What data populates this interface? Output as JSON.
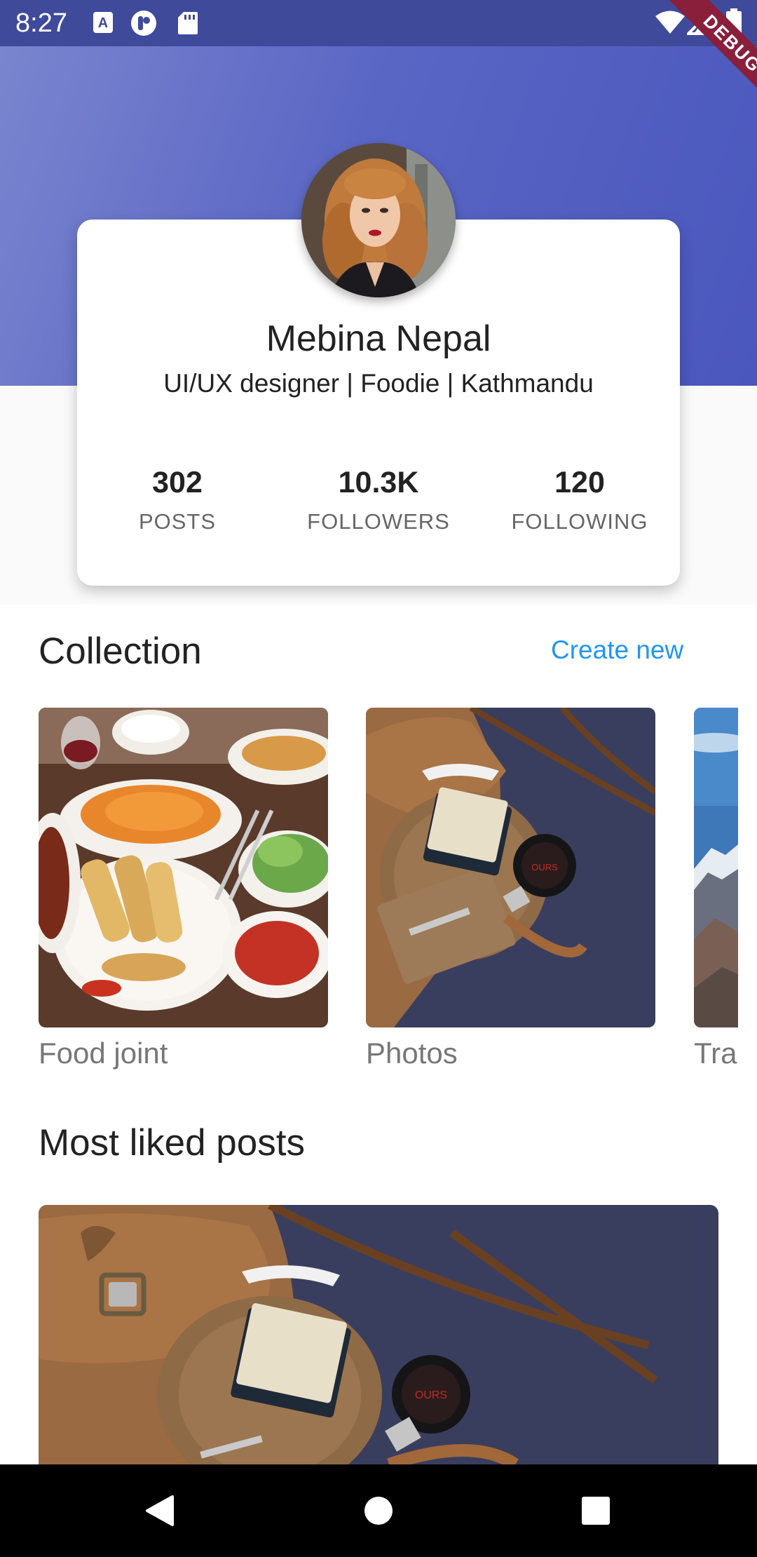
{
  "status_bar": {
    "time": "8:27",
    "icons": [
      "a-box-icon",
      "pocket-casts-icon",
      "sd-card-icon",
      "wifi-icon",
      "cell-signal-icon",
      "battery-icon"
    ]
  },
  "debug_banner": "DEBUG",
  "profile": {
    "name": "Mebina Nepal",
    "bio": "UI/UX designer | Foodie | Kathmandu",
    "stats": [
      {
        "value": "302",
        "label": "POSTS"
      },
      {
        "value": "10.3K",
        "label": "FOLLOWERS"
      },
      {
        "value": "120",
        "label": "FOLLOWING"
      }
    ]
  },
  "collection": {
    "title": "Collection",
    "action": "Create new",
    "items": [
      {
        "label": "Food joint",
        "image": "food-plate-photo"
      },
      {
        "label": "Photos",
        "image": "leather-bag-photo"
      },
      {
        "label": "Tra",
        "image": "mountain-landscape-photo"
      }
    ]
  },
  "most_liked": {
    "title": "Most liked posts",
    "image": "leather-bag-photo"
  },
  "nav_bar": {
    "buttons": [
      "back-icon",
      "home-icon",
      "recents-icon"
    ]
  },
  "colors": {
    "status_bar": "#3f4a9a",
    "header_gradient_start": "#7a85cf",
    "header_gradient_end": "#4a57bd",
    "accent": "#2196f3",
    "debug_ribbon": "#8a1f3c"
  }
}
